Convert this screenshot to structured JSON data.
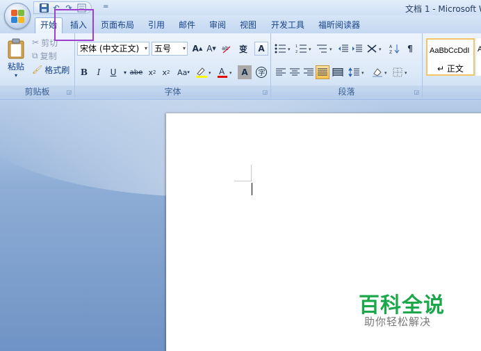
{
  "window": {
    "title": "文档 1 - Microsoft W"
  },
  "qat": {
    "dropdown_glyph": "="
  },
  "tabs": [
    {
      "label": "开始",
      "active": true
    },
    {
      "label": "插入",
      "active": false
    },
    {
      "label": "页面布局",
      "active": false
    },
    {
      "label": "引用",
      "active": false
    },
    {
      "label": "邮件",
      "active": false
    },
    {
      "label": "审阅",
      "active": false
    },
    {
      "label": "视图",
      "active": false
    },
    {
      "label": "开发工具",
      "active": false
    },
    {
      "label": "福昕阅读器",
      "active": false
    }
  ],
  "clipboard": {
    "paste_label": "粘贴",
    "cut_label": "剪切",
    "copy_label": "复制",
    "format_painter_label": "格式刷",
    "group_label": "剪贴板"
  },
  "font": {
    "font_name": "宋体 (中文正文)",
    "font_size": "五号",
    "group_label": "字体",
    "change_case": "Aa",
    "strike": "abe"
  },
  "paragraph": {
    "group_label": "段落"
  },
  "styles": {
    "sample_text": "AaBbCcDdI",
    "style_name": "↵ 正文",
    "next_sample": "A"
  },
  "watermark": {
    "title": "百科全说",
    "subtitle": "助你轻松解决"
  },
  "colors": {
    "accent": "#15428b",
    "highlight_box": "#9c3fcf",
    "watermark_green": "#1aa84a"
  }
}
